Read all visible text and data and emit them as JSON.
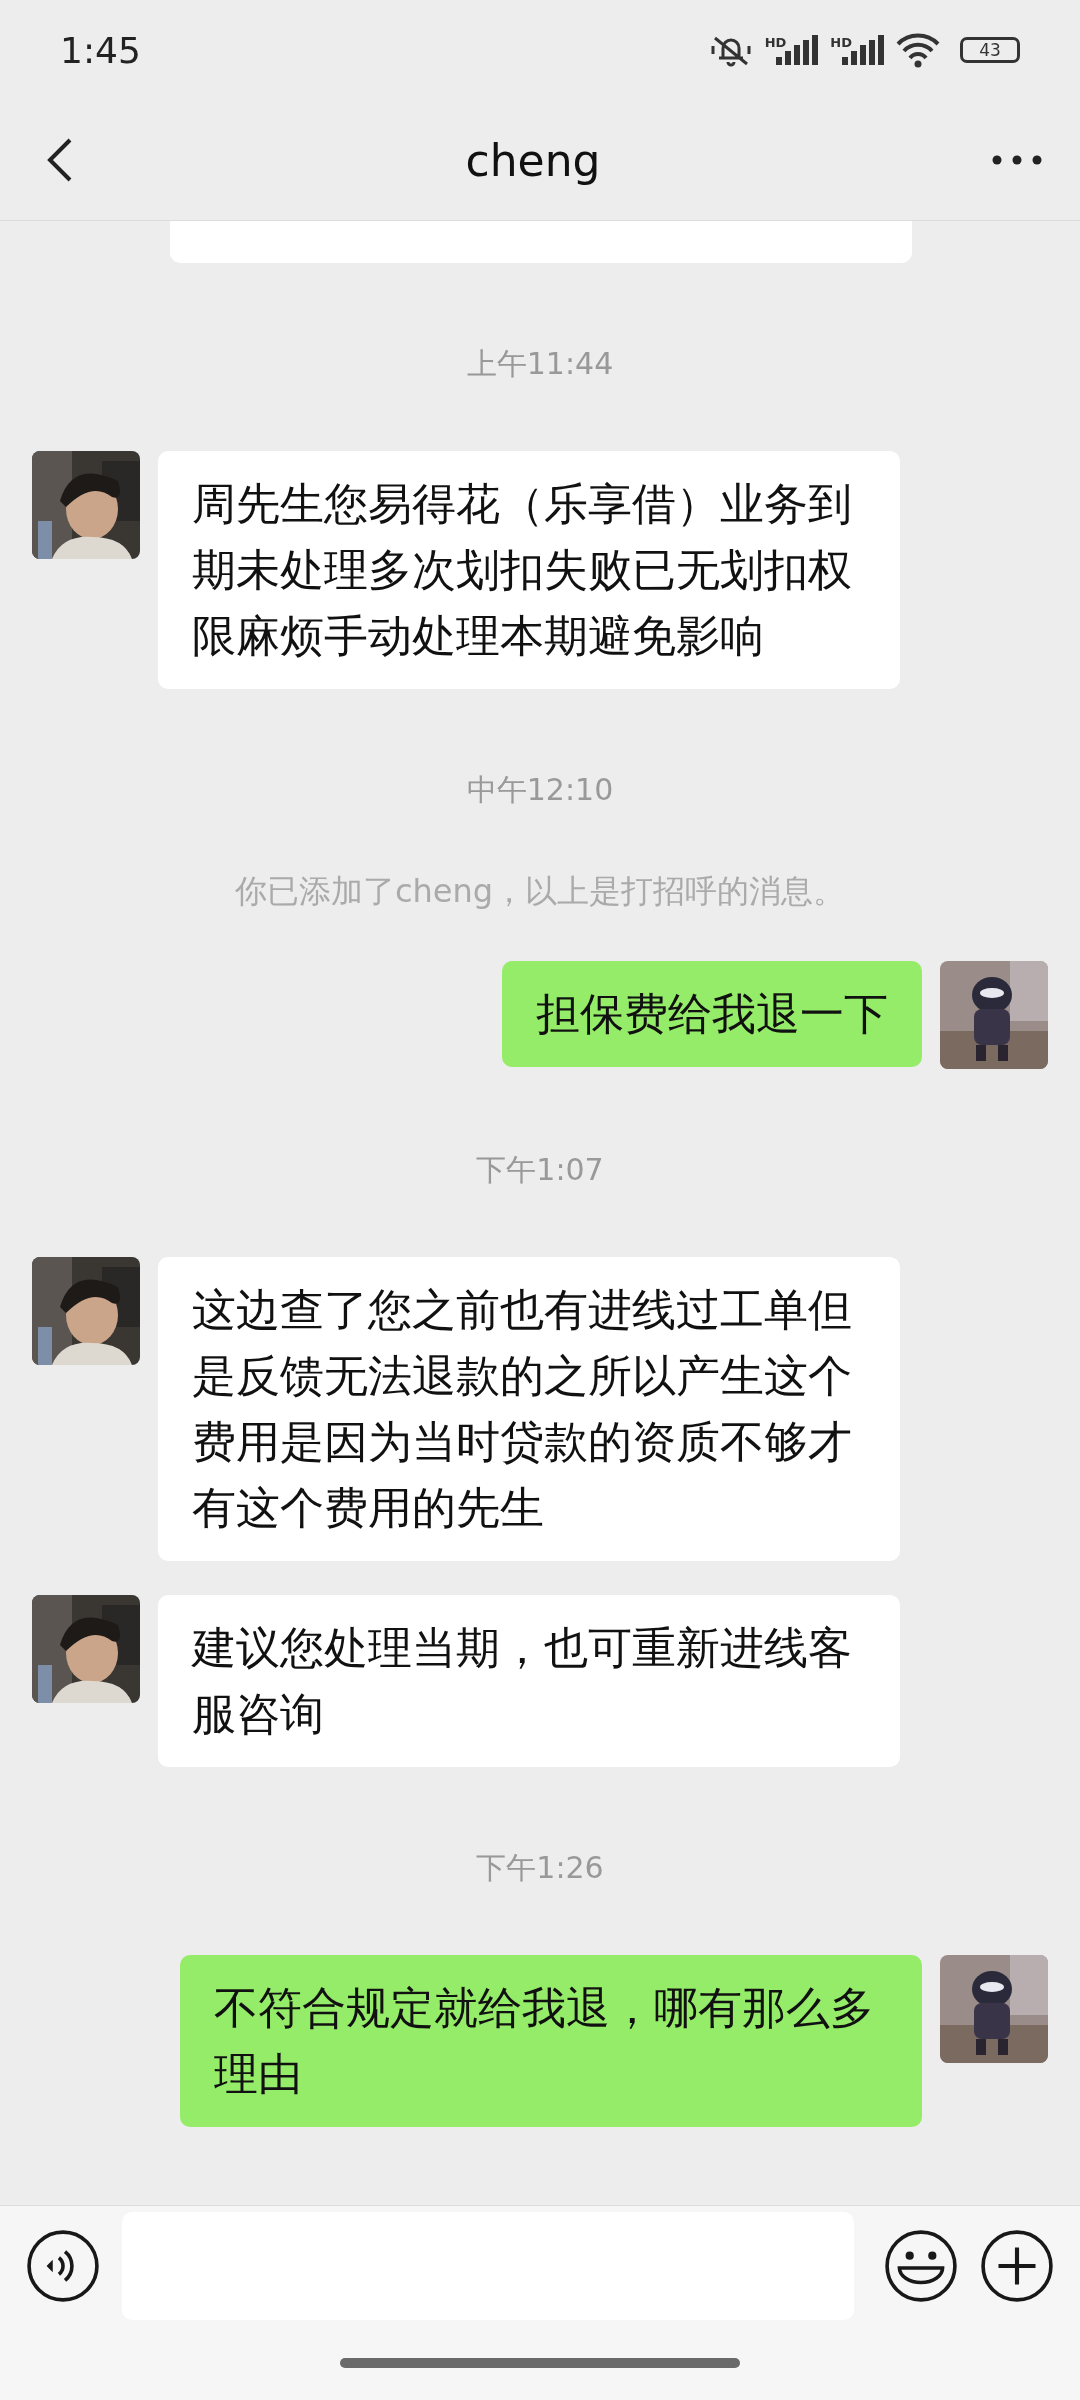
{
  "status_bar": {
    "time": "1:45",
    "signals": [
      {
        "label": "HD"
      },
      {
        "label": "HD"
      }
    ],
    "battery": "43"
  },
  "header": {
    "title": "cheng"
  },
  "messages": [
    {
      "kind": "partial"
    },
    {
      "kind": "time",
      "text": "上午11:44"
    },
    {
      "kind": "received",
      "text": "周先生您易得花（乐享借）业务到期未处理多次划扣失败已无划扣权限麻烦手动处理本期避免影响"
    },
    {
      "kind": "time",
      "text": "中午12:10"
    },
    {
      "kind": "system",
      "text": "你已添加了cheng，以上是打招呼的消息。"
    },
    {
      "kind": "sent",
      "text": "担保费给我退一下"
    },
    {
      "kind": "time",
      "text": "下午1:07"
    },
    {
      "kind": "received",
      "text": "这边查了您之前也有进线过工单但是反馈无法退款的之所以产生这个费用是因为当时贷款的资质不够才有这个费用的先生"
    },
    {
      "kind": "received",
      "text": "建议您处理当期，也可重新进线客服咨询"
    },
    {
      "kind": "time",
      "text": "下午1:26"
    },
    {
      "kind": "sent",
      "text": "不符合规定就给我退，哪有那么多理由"
    }
  ]
}
